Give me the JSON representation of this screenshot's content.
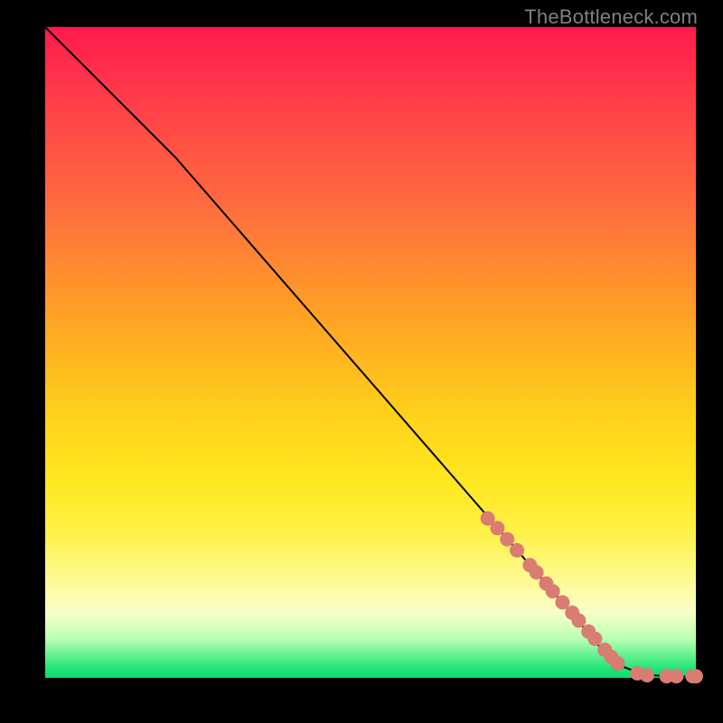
{
  "watermark": "TheBottleneck.com",
  "chart_data": {
    "type": "line",
    "title": "",
    "xlabel": "",
    "ylabel": "",
    "xlim": [
      0,
      100
    ],
    "ylim": [
      0,
      100
    ],
    "grid": false,
    "curve": {
      "x": [
        0,
        1,
        3,
        6,
        10,
        15,
        20,
        30,
        40,
        50,
        60,
        70,
        80,
        85,
        88,
        92,
        96,
        100
      ],
      "y": [
        100,
        99,
        97,
        94,
        90,
        85,
        80,
        68.5,
        57,
        45.5,
        34,
        22.5,
        11,
        5,
        2,
        0.5,
        0.2,
        0.2
      ]
    },
    "series": [
      {
        "name": "highlighted-points",
        "color": "#d97c72",
        "x": [
          68,
          69.5,
          71,
          72.5,
          74.5,
          75.5,
          77,
          78,
          79.5,
          81,
          82,
          83.5,
          84.5,
          86,
          87,
          88,
          91,
          92.5,
          95.5,
          97,
          99.5,
          100
        ],
        "y": [
          24.5,
          23,
          21.3,
          19.6,
          17.3,
          16.2,
          14.5,
          13.3,
          11.6,
          10,
          8.8,
          7.1,
          6,
          4.3,
          3.2,
          2.2,
          0.7,
          0.4,
          0.25,
          0.25,
          0.25,
          0.25
        ]
      }
    ]
  }
}
